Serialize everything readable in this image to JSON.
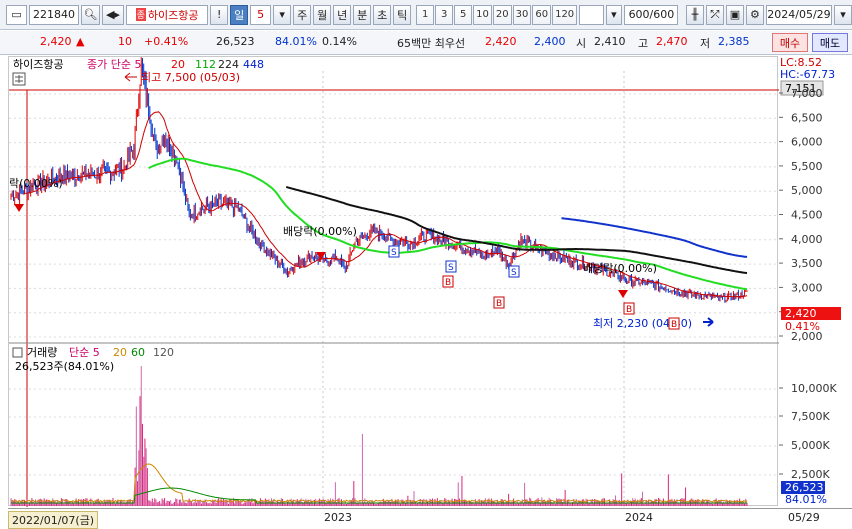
{
  "toolbar": {
    "code": "221840",
    "stock_name": "하이즈항공",
    "exclamation": "!",
    "period_day": "일",
    "period_value": "5",
    "period_week": "주",
    "period_month": "월",
    "period_year": "년",
    "period_minute": "분",
    "period_second": "초",
    "period_tick": "틱",
    "intervals": [
      "1",
      "3",
      "5",
      "10",
      "20",
      "30",
      "60",
      "120"
    ],
    "count": "600/600",
    "date": "2024/05/29"
  },
  "quote": {
    "price": "2,420",
    "change_arrow": "▲",
    "change": "10",
    "change_pct": "+0.41%",
    "volume": "26,523",
    "volume_ratio": "84.01%",
    "turnover": "0.14%",
    "low_label": "65백만 최우선",
    "ask": "2,420",
    "bid": "2,400",
    "open_label": "시",
    "open": "2,410",
    "high_label": "고",
    "high": "2,470",
    "low_label2": "저",
    "low": "2,385",
    "buy_label": "매수",
    "sell_label": "매도"
  },
  "price_panel": {
    "title": "하이즈항공",
    "legend_main": "종가 단순 5",
    "ma_values": [
      "20",
      "112",
      "224",
      "448"
    ],
    "ma_colors": [
      "#e60000",
      "#e60000",
      "#00cc00",
      "#222222",
      "#0022cc"
    ],
    "high_annotation": "최고 7,500 (05/03)",
    "low_annotation": "최저 2,230 (04/30)",
    "dividend_annotations": [
      "배당락(0.00%)",
      "배당락(0.00%)",
      "배당락(0.00%)"
    ],
    "left_annotation": "락(0.00%)",
    "lc_label": "LC:8.52",
    "hc_label": "HC:-67.73",
    "high_box": "7,151",
    "price_box": "2,420",
    "change_box": "0.41%"
  },
  "volume_panel": {
    "title": "거래량",
    "legend_main": "단순 5",
    "ma_values": [
      "20",
      "60",
      "120"
    ],
    "ma_colors": [
      "#cc8800",
      "#008800",
      "#555555"
    ],
    "volume_text": "26,523주(84.01%)",
    "volume_box": "26,523",
    "ratio_box": "84.01%"
  },
  "y_axis_price": [
    "7,000",
    "6,500",
    "6,000",
    "5,500",
    "5,000",
    "4,500",
    "4,000",
    "3,500",
    "3,000",
    "2,500",
    "2,000"
  ],
  "y_axis_volume": [
    "10,000K",
    "7,500K",
    "5,000K",
    "2,500K"
  ],
  "x_axis": {
    "start_date": "2022/01/07(금)",
    "label_2023": "2023",
    "label_2024": "2024",
    "end_date": "05/29"
  }
}
